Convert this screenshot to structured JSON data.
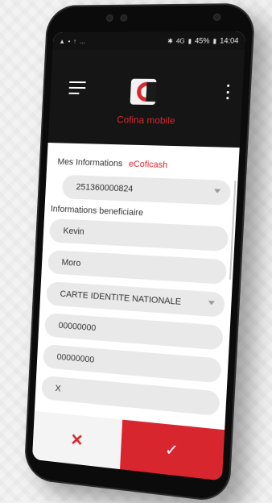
{
  "status_bar": {
    "battery": "45%",
    "time": "14:04",
    "network": "4G"
  },
  "app_bar": {
    "title": "Cofina mobile",
    "menu_icon": "hamburger-menu-icon",
    "more_icon": "vertical-dots-icon"
  },
  "tabs": [
    {
      "label": "Mes Informations"
    },
    {
      "label": "eCoficash"
    }
  ],
  "account_field": {
    "value": "251360000824"
  },
  "beneficiary_section": {
    "label": "Informations beneficiaire"
  },
  "fields": [
    {
      "value": "Kevin"
    },
    {
      "value": "Moro"
    },
    {
      "value": "CARTE IDENTITE NATIONALE"
    },
    {
      "value": "00000000"
    },
    {
      "value": "00000000"
    },
    {
      "value": "X"
    }
  ],
  "actions": {
    "cancel_icon": "✕",
    "confirm_icon": "✓"
  },
  "colors": {
    "accent": "#d8262f",
    "appbar": "#151515",
    "field_bg": "#e9e9e9"
  }
}
